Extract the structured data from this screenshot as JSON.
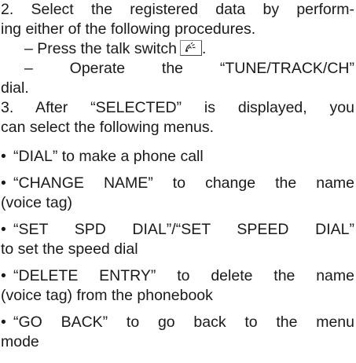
{
  "step2": {
    "line1": "2. Select the registered data by perform-",
    "line2": "ing either of the following procedures.",
    "sub1_prefix": "– Press the talk switch",
    "sub1_suffix": ".",
    "sub2_line1": "– Operate the “TUNE/TRACK/CH”",
    "sub2_line2": "dial."
  },
  "step3": {
    "line1": "3. After “SELECTED” is displayed, you",
    "line2": "can select the following menus."
  },
  "bullets": [
    {
      "line1": "“DIAL” to make a phone call"
    },
    {
      "line1": "“CHANGE NAME” to change the name",
      "line2": "(voice tag)"
    },
    {
      "line1": "“SET SPD DIAL”/“SET SPEED DIAL”",
      "line2": "to set the speed dial"
    },
    {
      "line1": "“DELETE ENTRY” to delete the name",
      "line2": "(voice tag) from the phonebook"
    },
    {
      "line1": "“GO BACK” to go back to the menu",
      "line2": "mode"
    }
  ],
  "icons": {
    "talk_switch": "talk-switch-icon"
  }
}
